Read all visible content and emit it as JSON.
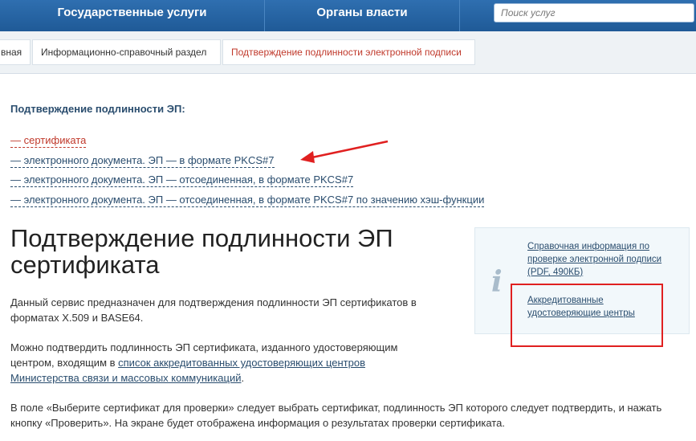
{
  "topnav": {
    "tab1": "Государственные услуги",
    "tab2": "Органы власти",
    "search_placeholder": "Поиск услуг"
  },
  "breadcrumb": {
    "home": "вная",
    "section": "Информационно-справочный раздел",
    "current": "Подтверждение подлинности электронной подписи"
  },
  "links": {
    "heading": "Подтверждение подлинности ЭП:",
    "items": [
      "— сертификата",
      "— электронного документа. ЭП — в формате PKCS#7",
      "— электронного документа. ЭП — отсоединенная, в формате PKCS#7",
      "— электронного документа. ЭП — отсоединенная, в формате PKCS#7 по значению хэш-функции"
    ]
  },
  "main": {
    "title": "Подтверждение подлинности ЭП сертификата",
    "para1": "Данный сервис предназначен для подтверждения подлинности ЭП сертификатов в форматах X.509 и BASE64.",
    "para2_pre": "Можно подтвердить подлинность ЭП сертификата, изданного удостоверяющим центром, входящим в ",
    "para2_link": "список аккредитованных удостоверяющих центров Министерства связи и массовых коммуникаций",
    "para2_post": ".",
    "para3": "В поле «Выберите сертификат для проверки» следует выбрать сертификат, подлинность ЭП которого следует подтвердить, и нажать кнопку «Проверить». На экране будет отображена информация о результатах проверки сертификата."
  },
  "sidebar": {
    "icon": "info-icon",
    "link1": "Справочная информация по проверке электронной подписи (PDF, 490КБ)",
    "link2": "Аккредитованные удостоверяющие центры"
  },
  "colors": {
    "nav": "#2f6fb0",
    "link": "#2a4d6e",
    "active": "#c0392b",
    "annotation": "#e02020"
  }
}
